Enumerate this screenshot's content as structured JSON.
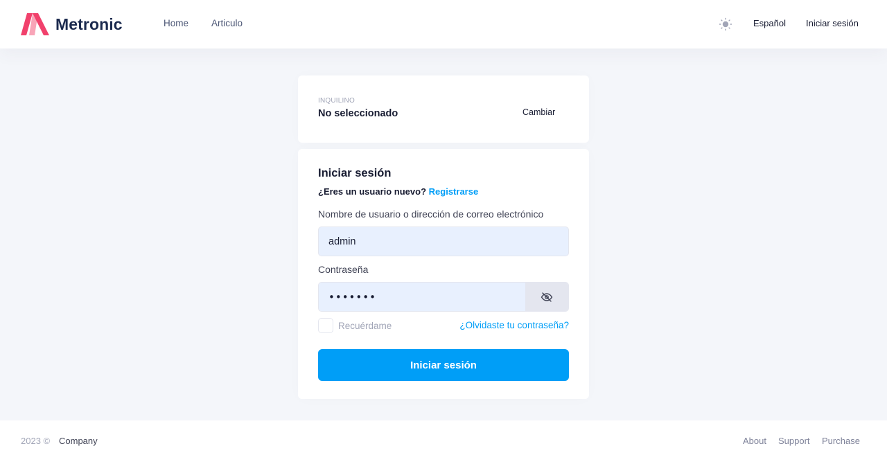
{
  "header": {
    "brand": "Metronic",
    "nav": [
      {
        "label": "Home"
      },
      {
        "label": "Articulo"
      }
    ],
    "theme_icon": "sun-icon",
    "language": "Español",
    "login": "Iniciar sesión"
  },
  "tenant": {
    "label": "INQUILINO",
    "value": "No seleccionado",
    "change": "Cambiar"
  },
  "login": {
    "title": "Iniciar sesión",
    "new_user": "¿Eres un usuario nuevo?",
    "register": "Registrarse",
    "username_label": "Nombre de usuario o dirección de correo electrónico",
    "username_value": "admin",
    "password_label": "Contraseña",
    "password_value": "•••••••",
    "eye_icon": "eye-off-icon",
    "remember": "Recuérdame",
    "forgot": "¿Olvidaste tu contraseña?",
    "submit": "Iniciar sesión"
  },
  "footer": {
    "year": "2023 ©",
    "company": "Company",
    "links": [
      {
        "label": "About"
      },
      {
        "label": "Support"
      },
      {
        "label": "Purchase"
      }
    ]
  },
  "colors": {
    "primary": "#009ef7",
    "background": "#f4f6fa",
    "input_bg": "#e8f0fe",
    "logo_pink": "#f1416c",
    "text_dark": "#181c32"
  }
}
